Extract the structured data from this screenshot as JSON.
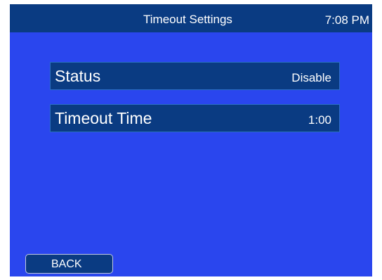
{
  "header": {
    "title": "Timeout Settings",
    "clock": "7:08 PM"
  },
  "settings": [
    {
      "label": "Status",
      "value": "Disable"
    },
    {
      "label": "Timeout Time",
      "value": "1:00"
    }
  ],
  "footer": {
    "back_label": "BACK"
  },
  "colors": {
    "background": "#2a46ee",
    "bar": "#0a3b82",
    "text": "#ffffff"
  }
}
